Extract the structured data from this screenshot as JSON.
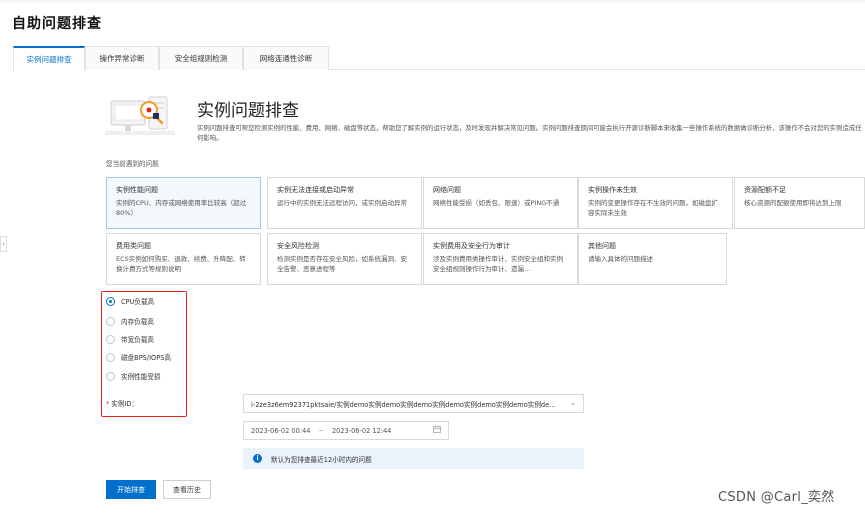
{
  "page": {
    "title": "自助问题排查"
  },
  "tabs": [
    {
      "label": "实例问题排查",
      "active": true
    },
    {
      "label": "操作异常诊断",
      "active": false
    },
    {
      "label": "安全组规则检测",
      "active": false
    },
    {
      "label": "网络连通性诊断",
      "active": false
    }
  ],
  "hero": {
    "title": "实例问题排查",
    "description": "实例问题排查可帮您检测实例的性能、费用、网络、磁盘等状态，帮助您了解实例的运行状态，及时发现并解决常见问题。实例问题排查期间可能会执行开源诊断脚本来收集一些操作系统的数据做诊断分析，该操作不会对您的实例造成任何影响。"
  },
  "problem_prompt": "您当前遇到的问题",
  "cards": [
    {
      "title": "实例性能问题",
      "desc": "实例的CPU、内存或网络使用率比较高（超过80%）",
      "selected": true
    },
    {
      "title": "实例无法连接或启动异常",
      "desc": "运行中的实例无法远程访问，或实例启动异常"
    },
    {
      "title": "网络问题",
      "desc": "网络性能受损（如丢包、限速）或PING不通"
    },
    {
      "title": "实例操作未生效",
      "desc": "实例的变更操作存在不生效的问题，如磁盘扩容实际未生效"
    },
    {
      "title": "资源配额不足",
      "desc": "核心资源的配额使用即将达到上限"
    },
    {
      "title": "费用类问题",
      "desc": "ECS实例如何购买、退款、续费、升降配、转换计费方式等规则说明"
    },
    {
      "title": "安全风险检测",
      "desc": "检测实例是否存在安全风险，如系统漏洞、安全告警、恶意进程等"
    },
    {
      "title": "实例费用及安全行为审计",
      "desc": "涉及实例费用类操作审计、实例安全组和实例安全组规则操作行为审计、遗漏…"
    },
    {
      "title": "其他问题",
      "desc": "请输入具体的问题描述"
    }
  ],
  "radio_options": [
    {
      "label": "CPU负载高",
      "checked": true
    },
    {
      "label": "内存负载高",
      "checked": false
    },
    {
      "label": "带宽负载高",
      "checked": false
    },
    {
      "label": "磁盘BPS/IOPS高",
      "checked": false
    },
    {
      "label": "实例性能受损",
      "checked": false
    }
  ],
  "instance": {
    "required_mark": "*",
    "label": "实例ID：",
    "value": "i-2ze3z6em92371pktsaie/实例demo实例demo实例demo实例demo实例demo实例demo实例de…"
  },
  "time_range": {
    "start": "2023-06-02 00:44",
    "separator": "~",
    "end": "2023-06-02 12:44"
  },
  "notice": {
    "text": "默认为您排查最近12小时内的问题"
  },
  "buttons": {
    "start": "开始排查",
    "history": "查看历史"
  },
  "watermark": "CSDN @Carl_奕然",
  "colors": {
    "primary": "#0070cc",
    "highlight_border": "#e8221d",
    "notice_bg": "#eaf2fb"
  }
}
